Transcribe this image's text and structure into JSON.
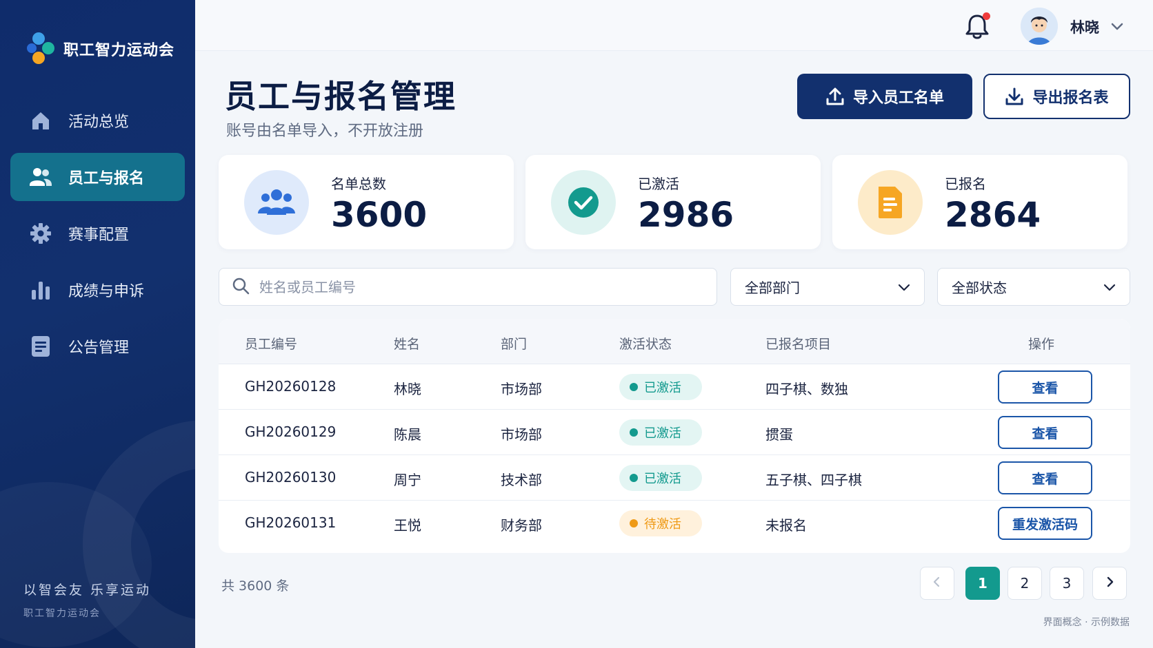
{
  "app": {
    "name": "职工智力运动会"
  },
  "sidebar": {
    "items": [
      {
        "label": "活动总览",
        "icon": "home-icon"
      },
      {
        "label": "员工与报名",
        "icon": "users-icon"
      },
      {
        "label": "赛事配置",
        "icon": "gear-icon"
      },
      {
        "label": "成绩与申诉",
        "icon": "bar-chart-icon"
      },
      {
        "label": "公告管理",
        "icon": "document-icon"
      }
    ],
    "slogan": "以智会友 乐享运动",
    "slogan_sub": "职工智力运动会"
  },
  "topbar": {
    "user_name": "林晓"
  },
  "header": {
    "title": "员工与报名管理",
    "subtitle": "账号由名单导入，不开放注册",
    "import_label": "导入员工名单",
    "export_label": "导出报名表"
  },
  "stats": [
    {
      "label": "名单总数",
      "value": "3600"
    },
    {
      "label": "已激活",
      "value": "2986"
    },
    {
      "label": "已报名",
      "value": "2864"
    }
  ],
  "filters": {
    "search_placeholder": "姓名或员工编号",
    "dept": "全部部门",
    "status": "全部状态"
  },
  "table": {
    "columns": [
      "员工编号",
      "姓名",
      "部门",
      "激活状态",
      "已报名项目",
      "操作"
    ],
    "rows": [
      {
        "id": "GH20260128",
        "name": "林晓",
        "dept": "市场部",
        "status": "已激活",
        "events": "四子棋、数独",
        "action": "查看"
      },
      {
        "id": "GH20260129",
        "name": "陈晨",
        "dept": "市场部",
        "status": "已激活",
        "events": "掼蛋",
        "action": "查看"
      },
      {
        "id": "GH20260130",
        "name": "周宁",
        "dept": "技术部",
        "status": "已激活",
        "events": "五子棋、四子棋",
        "action": "查看"
      },
      {
        "id": "GH20260131",
        "name": "王悦",
        "dept": "财务部",
        "status": "待激活",
        "events": "未报名",
        "action": "重发激活码"
      }
    ]
  },
  "footer": {
    "total": "共 3600 条",
    "pages": [
      "1",
      "2",
      "3"
    ],
    "note": "界面概念 · 示例数据"
  },
  "colors": {
    "primary": "#12306e",
    "accent": "#139a8e",
    "warning": "#ef9a16",
    "link": "#1a55a8"
  }
}
